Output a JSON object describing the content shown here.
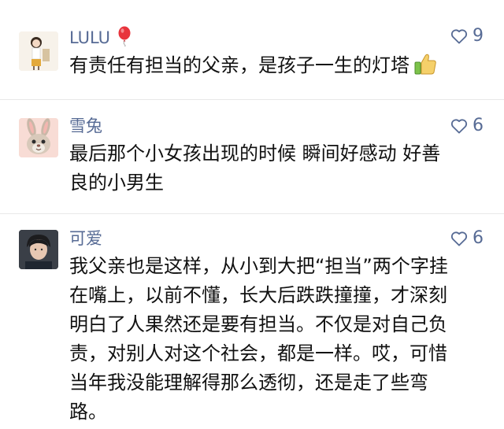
{
  "comments": [
    {
      "name": "LULU",
      "likes": "9",
      "lines": [
        "有责任有担当的父亲，是孩子一生的灯塔"
      ],
      "emoji_after_name": "red-balloon-icon",
      "emoji_after_text": "thumbs-up-icon"
    },
    {
      "name": "雪兔",
      "likes": "6",
      "lines": [
        "最后那个小女孩出现的时候 瞬间好感动 好善",
        "良的小男生"
      ]
    },
    {
      "name": "可爱",
      "likes": "6",
      "lines": [
        "我父亲也是这样，从小到大把“担当”两个字挂",
        "在嘴上，以前不懂，长大后跌跌撞撞，才深刻",
        "明白了人果然还是要有担当。不仅是对自己负",
        "责，对别人对这个社会，都是一样。哎，可惜",
        "当年我没能理解得那么透彻，还是走了些弯",
        "路。"
      ]
    }
  ],
  "colors": {
    "name": "#576b95",
    "text": "#111111",
    "heart": "#576b95"
  }
}
